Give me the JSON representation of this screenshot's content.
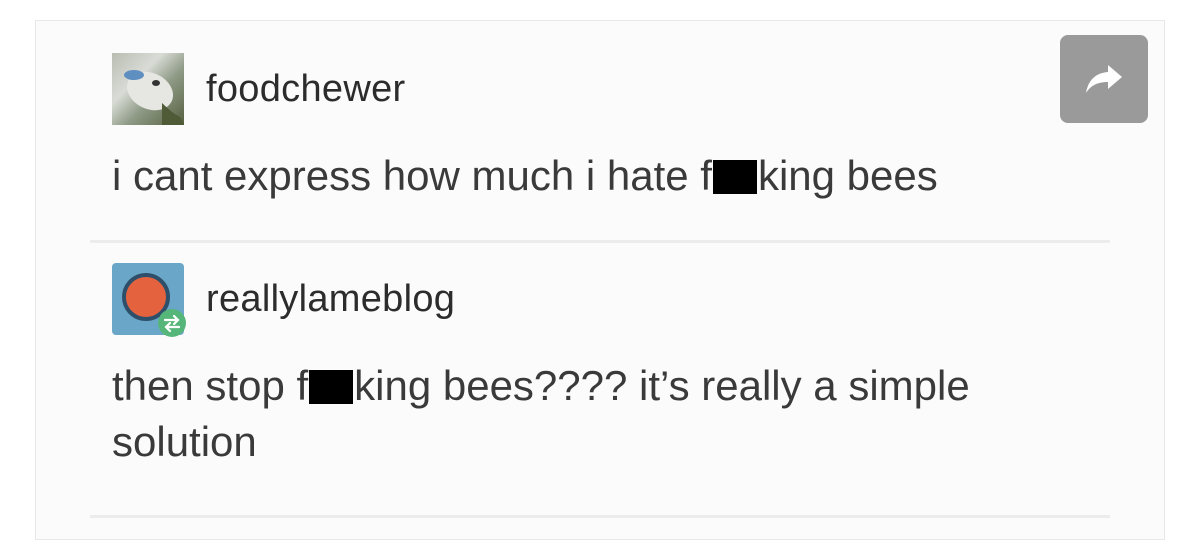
{
  "share_button": {
    "icon": "share-arrow-icon",
    "color": "#9a9a9a"
  },
  "posts": [
    {
      "username": "foodchewer",
      "avatar_icon": "dog-avatar-icon",
      "text_before": "i cant express how much i hate f",
      "text_after": "king bees"
    },
    {
      "username": "reallylameblog",
      "avatar_icon": "reblog-avatar-icon",
      "text_before": "then stop f",
      "text_after": "king bees???? it’s really a simple solution"
    }
  ]
}
